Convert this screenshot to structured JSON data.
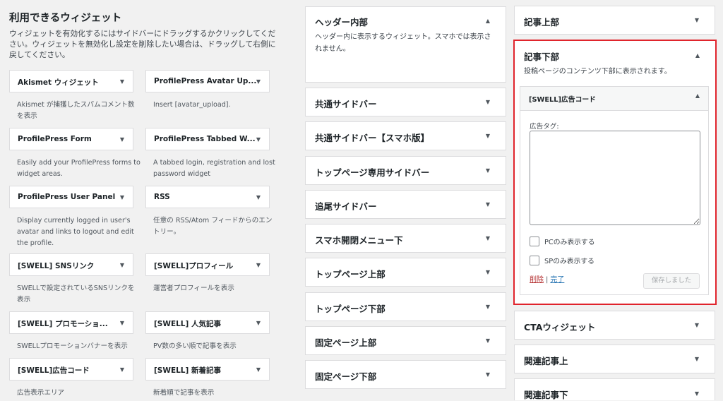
{
  "available": {
    "title": "利用できるウィジェット",
    "description": "ウィジェットを有効化するにはサイドバーにドラッグするかクリックしてください。ウィジェットを無効化し設定を削除したい場合は、ドラッグして右側に戻してください。",
    "widgets": [
      {
        "title": "Akismet ウィジェット",
        "desc": "Akismet が捕獲したスパムコメント数を表示"
      },
      {
        "title": "ProfilePress Avatar Up...",
        "desc": "Insert [avatar_upload]."
      },
      {
        "title": "ProfilePress Form",
        "desc": "Easily add your ProfilePress forms to widget areas."
      },
      {
        "title": "ProfilePress Tabbed W...",
        "desc": "A tabbed login, registration and lost password widget"
      },
      {
        "title": "ProfilePress User Panel",
        "desc": "Display currently logged in user's avatar and links to logout and edit the profile."
      },
      {
        "title": "RSS",
        "desc": "任意の RSS/Atom フィードからのエントリー。"
      },
      {
        "title": "[SWELL] SNSリンク",
        "desc": "SWELLで設定されているSNSリンクを表示"
      },
      {
        "title": "[SWELL]プロフィール",
        "desc": "運営者プロフィールを表示"
      },
      {
        "title": "[SWELL] プロモーショ...",
        "desc": "SWELLプロモーションバナーを表示"
      },
      {
        "title": "[SWELL] 人気記事",
        "desc": "PV数の多い順で記事を表示"
      },
      {
        "title": "[SWELL]広告コード",
        "desc": "広告表示エリア"
      },
      {
        "title": "[SWELL] 新着記事",
        "desc": "新着順で記事を表示"
      }
    ]
  },
  "middle": {
    "header": {
      "title": "ヘッダー内部",
      "desc": "ヘッダー内に表示するウィジェット。スマホでは表示されません。"
    },
    "areas": [
      "共通サイドバー",
      "共通サイドバー【スマホ版】",
      "トップページ専用サイドバー",
      "追尾サイドバー",
      "スマホ開閉メニュー下",
      "トップページ上部",
      "トップページ下部",
      "固定ページ上部",
      "固定ページ下部"
    ]
  },
  "right": {
    "top_area": "記事上部",
    "expanded": {
      "title": "記事下部",
      "desc": "投稿ページのコンテンツ下部に表示されます。",
      "widget": {
        "title": "[SWELL]広告コード",
        "field_label": "広告タグ:",
        "field_value": "",
        "pc_only": "PCのみ表示する",
        "sp_only": "SPのみ表示する",
        "delete": "削除",
        "separator": "|",
        "done": "完了",
        "saved": "保存しました"
      }
    },
    "areas": [
      "CTAウィジェット",
      "関連記事上",
      "関連記事下"
    ]
  },
  "icons": {
    "collapsed": "triangle-down-icon",
    "expanded": "triangle-up-icon"
  },
  "colors": {
    "highlight_border": "#e0242c",
    "delete_link": "#b32d2e",
    "done_link": "#2271b1"
  }
}
